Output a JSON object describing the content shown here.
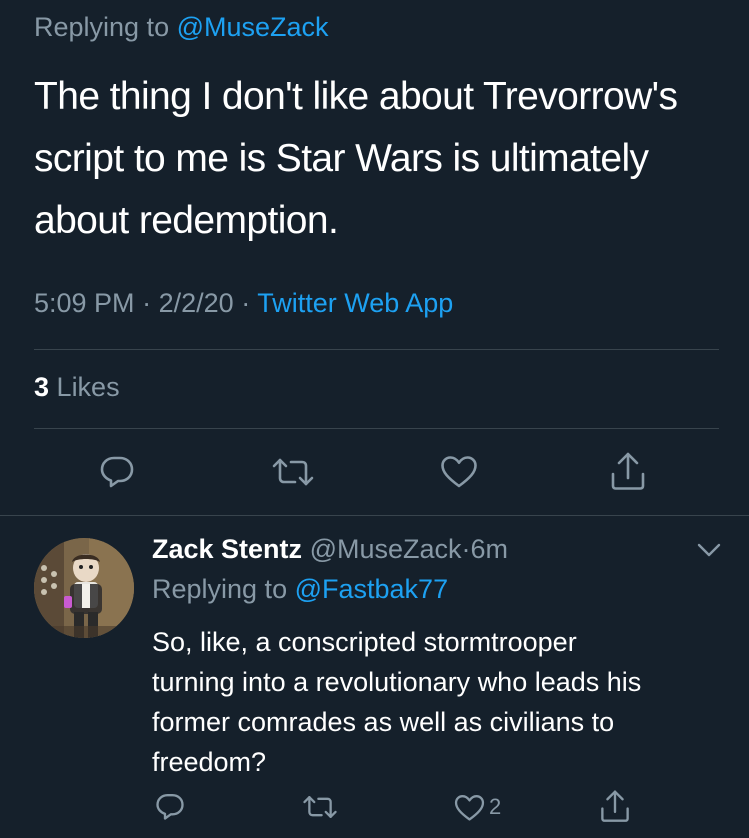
{
  "main_tweet": {
    "replying_prefix": "Replying to",
    "replying_handle": "@MuseZack",
    "text_lines": [
      "The thing I don't like about Trevorrow's",
      "script to me is Star Wars is ultimately",
      "about redemption."
    ],
    "time": "5:09 PM",
    "date": "2/2/20",
    "separator": "·",
    "source": "Twitter Web App",
    "likes_count": "3",
    "likes_label": "Likes"
  },
  "reply_tweet": {
    "name": "Zack Stentz",
    "handle": "@MuseZack",
    "time_ago": "6m",
    "separator": "·",
    "replying_prefix": "Replying to",
    "replying_handle": "@Fastbak77",
    "text_lines": [
      "So, like, a conscripted stormtrooper",
      "turning into a revolutionary who leads his",
      "former comrades as well as civilians to",
      "freedom?"
    ],
    "like_count": "2"
  },
  "icons": {
    "reply": "reply-icon",
    "retweet": "retweet-icon",
    "like": "heart-icon",
    "share": "share-icon",
    "more": "chevron-down-icon"
  },
  "colors": {
    "background": "#15202b",
    "primary_text": "#ffffff",
    "secondary_text": "#8899a6",
    "accent": "#1da1f2",
    "divider": "#38444d"
  }
}
